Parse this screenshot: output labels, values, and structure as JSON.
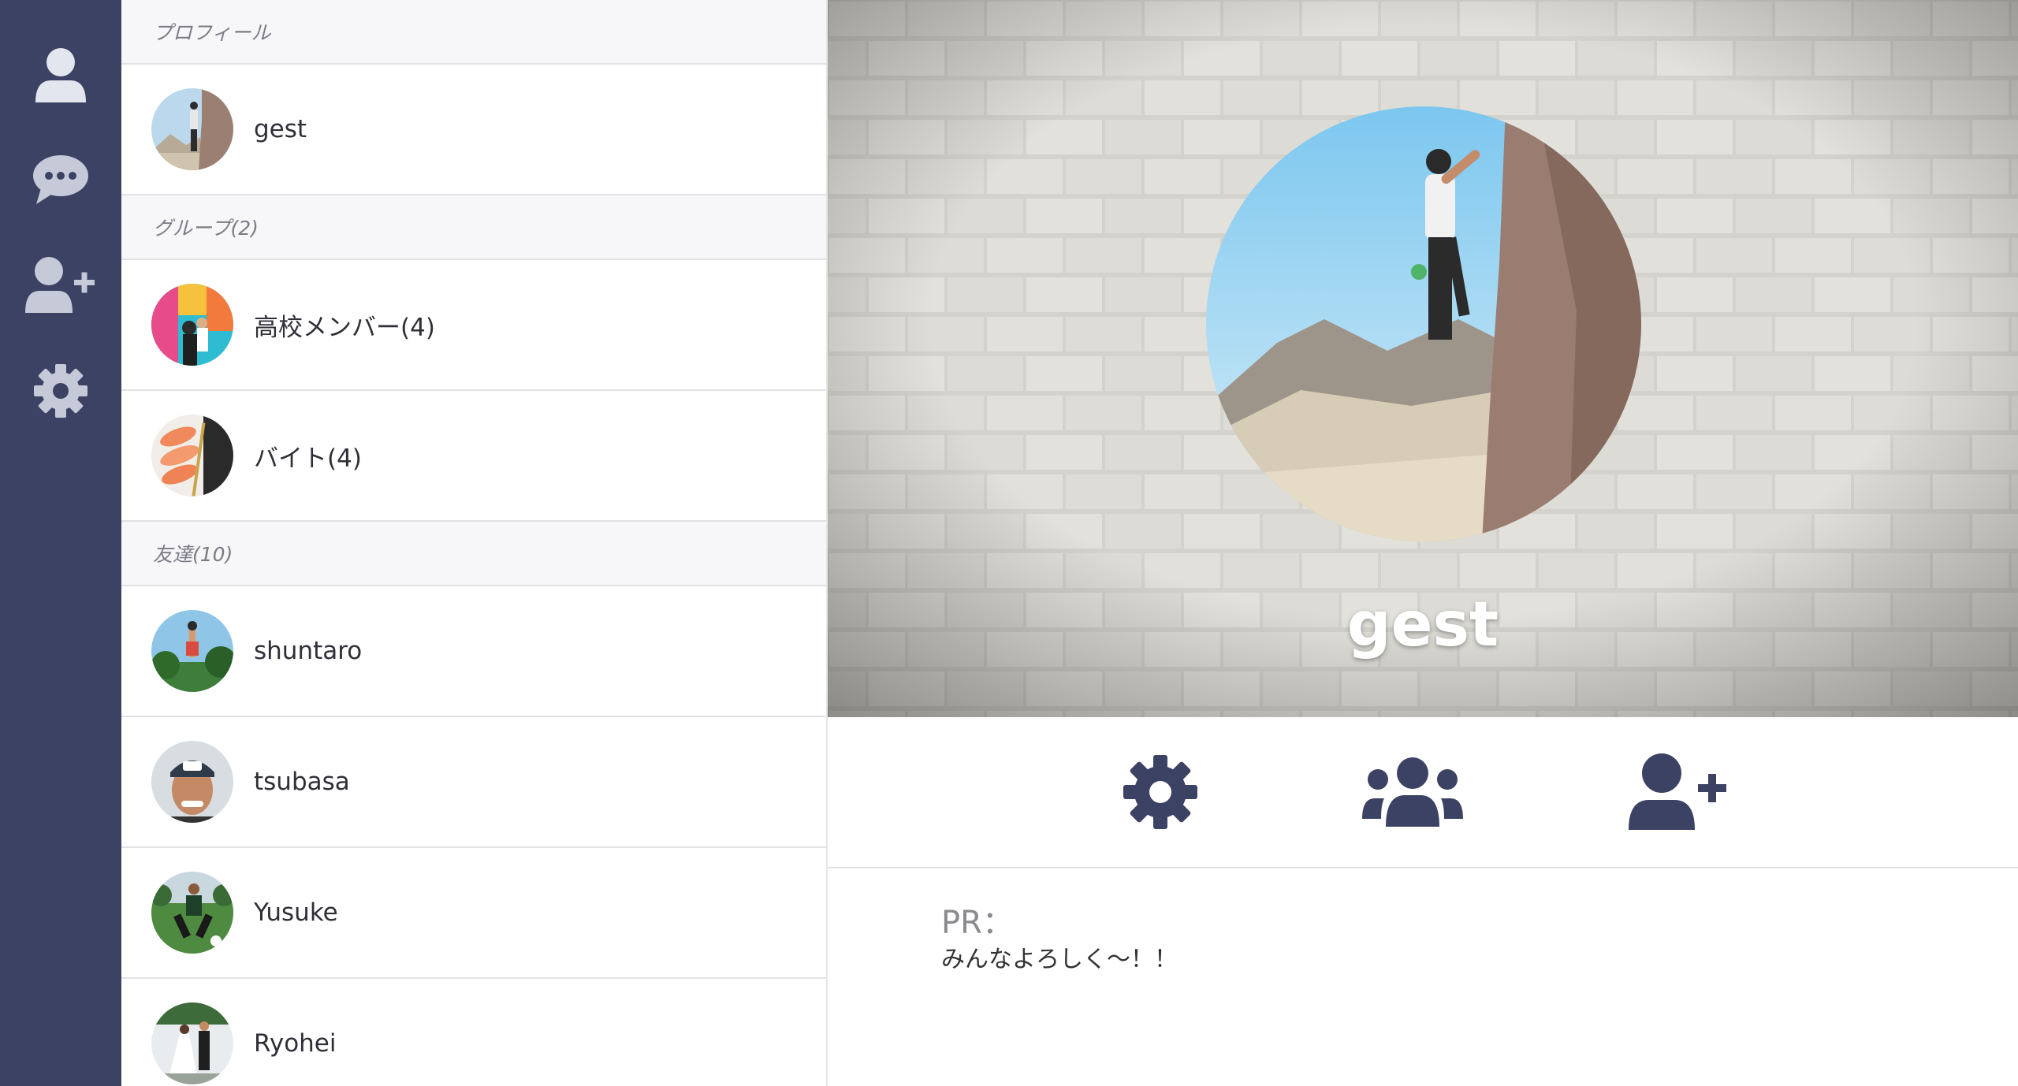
{
  "rail": {
    "items": [
      {
        "icon": "user-icon",
        "active": true
      },
      {
        "icon": "chat-bubble-icon",
        "active": false
      },
      {
        "icon": "add-user-icon",
        "active": false
      },
      {
        "icon": "gear-icon",
        "active": false
      }
    ]
  },
  "sections": {
    "profile": {
      "header": "プロフィール",
      "items": [
        {
          "name": "gest"
        }
      ]
    },
    "groups": {
      "header": "グループ(2)",
      "items": [
        {
          "name": "高校メンバー(4)"
        },
        {
          "name": "バイト(4)"
        }
      ]
    },
    "friends": {
      "header": "友達(10)",
      "items": [
        {
          "name": "shuntaro"
        },
        {
          "name": "tsubasa"
        },
        {
          "name": "Yusuke"
        },
        {
          "name": "Ryohei"
        }
      ]
    }
  },
  "profile": {
    "name": "gest",
    "pr_title": "PR：",
    "pr_text": "みんなよろしく〜！！",
    "actions": [
      {
        "icon": "gear-icon"
      },
      {
        "icon": "group-icon"
      },
      {
        "icon": "add-user-icon"
      }
    ]
  },
  "colors": {
    "rail_bg": "#3b4263",
    "rail_icon": "#c5c9d8",
    "action_icon": "#3b4263",
    "header_bg": "#f7f7f9"
  }
}
